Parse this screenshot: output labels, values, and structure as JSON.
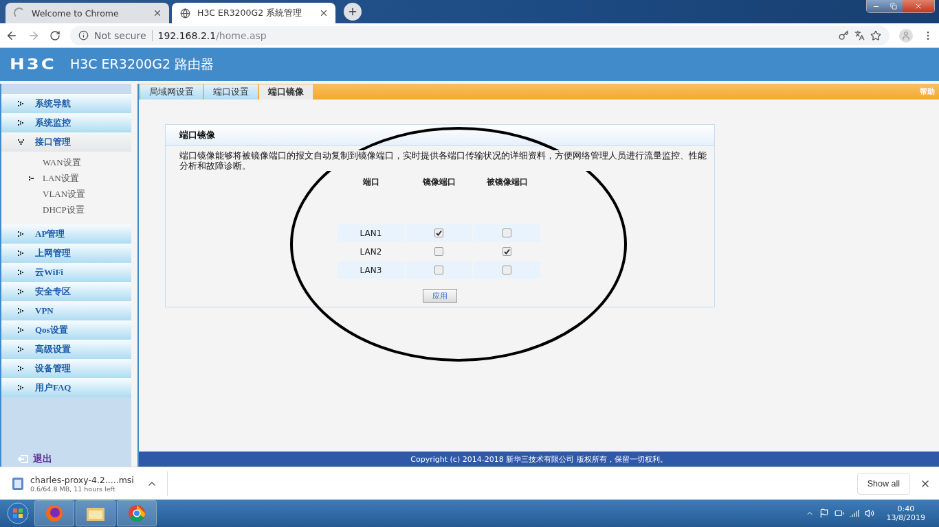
{
  "browser": {
    "tabs": [
      {
        "title": "Welcome to Chrome",
        "selected": false
      },
      {
        "title": "H3C ER3200G2 系統管理",
        "selected": true
      }
    ],
    "url": {
      "security": "Not secure",
      "host": "192.168.2.1",
      "path": "/home.asp"
    }
  },
  "header": {
    "logo": "H3C",
    "title": "H3C ER3200G2 路由器"
  },
  "sidebar": {
    "items": [
      {
        "label": "系统导航",
        "expanded": false
      },
      {
        "label": "系统监控",
        "expanded": false
      },
      {
        "label": "接口管理",
        "expanded": true,
        "children": [
          {
            "label": "WAN设置",
            "selected": false
          },
          {
            "label": "LAN设置",
            "selected": true
          },
          {
            "label": "VLAN设置",
            "selected": false
          },
          {
            "label": "DHCP设置",
            "selected": false
          }
        ]
      },
      {
        "label": "AP管理",
        "expanded": false
      },
      {
        "label": "上网管理",
        "expanded": false
      },
      {
        "label": "云WiFi",
        "expanded": false
      },
      {
        "label": "安全专区",
        "expanded": false
      },
      {
        "label": "VPN",
        "expanded": false
      },
      {
        "label": "Qos设置",
        "expanded": false
      },
      {
        "label": "高级设置",
        "expanded": false
      },
      {
        "label": "设备管理",
        "expanded": false
      },
      {
        "label": "用户FAQ",
        "expanded": false
      }
    ],
    "logout": "退出"
  },
  "tabs": [
    {
      "label": "局域网设置",
      "selected": false
    },
    {
      "label": "端口设置",
      "selected": false
    },
    {
      "label": "端口镜像",
      "selected": true
    }
  ],
  "help": "帮助",
  "panel": {
    "title": "端口镜像",
    "description": "端口镜像能够将被镜像端口的报文自动复制到镜像端口，实时提供各端口传输状况的详细资料，方便网络管理人员进行流量监控、性能分析和故障诊断。",
    "columns": [
      "端口",
      "镜像端口",
      "被镜像端口"
    ],
    "rows": [
      {
        "port": "LAN1",
        "mirror": true,
        "mirrored": false
      },
      {
        "port": "LAN2",
        "mirror": false,
        "mirrored": true
      },
      {
        "port": "LAN3",
        "mirror": false,
        "mirrored": false
      }
    ],
    "apply": "应用"
  },
  "footer": "Copyright (c) 2014-2018 新华三技术有限公司 版权所有，保留一切权利。",
  "download": {
    "file": "charles-proxy-4.2.....msi",
    "status": "0.6/64.8 MB, 11 hours left",
    "show_all": "Show all"
  },
  "taskbar": {
    "time": "0:40",
    "date": "13/8/2019"
  }
}
